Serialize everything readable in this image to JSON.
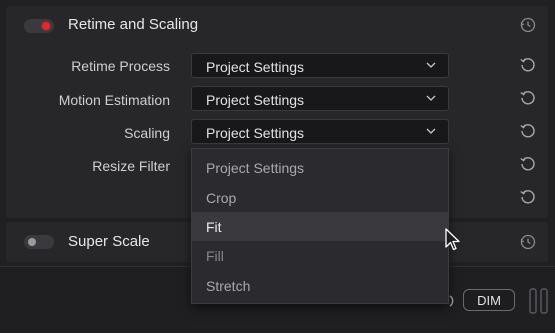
{
  "retime_section": {
    "title": "Retime and Scaling",
    "enabled": true,
    "rows": [
      {
        "label": "Retime Process",
        "value": "Project Settings"
      },
      {
        "label": "Motion Estimation",
        "value": "Project Settings"
      },
      {
        "label": "Scaling",
        "value": "Project Settings"
      },
      {
        "label": "Resize Filter",
        "value": ""
      },
      {
        "label": "",
        "value": ""
      }
    ]
  },
  "scaling_dropdown": {
    "options": [
      "Project Settings",
      "Crop",
      "Fit",
      "Fill",
      "Stretch"
    ],
    "highlighted": "Fit"
  },
  "super_scale_section": {
    "title": "Super Scale",
    "enabled": false
  },
  "bottom_bar": {
    "dim_label": "DIM"
  },
  "colors": {
    "toggle_on": "#e0292b",
    "panel": "#27272a",
    "field": "#18181a"
  },
  "icons": {
    "reset": "reset-icon",
    "chevron": "chevron-down-icon",
    "cursor": "mouse-pointer-icon"
  }
}
